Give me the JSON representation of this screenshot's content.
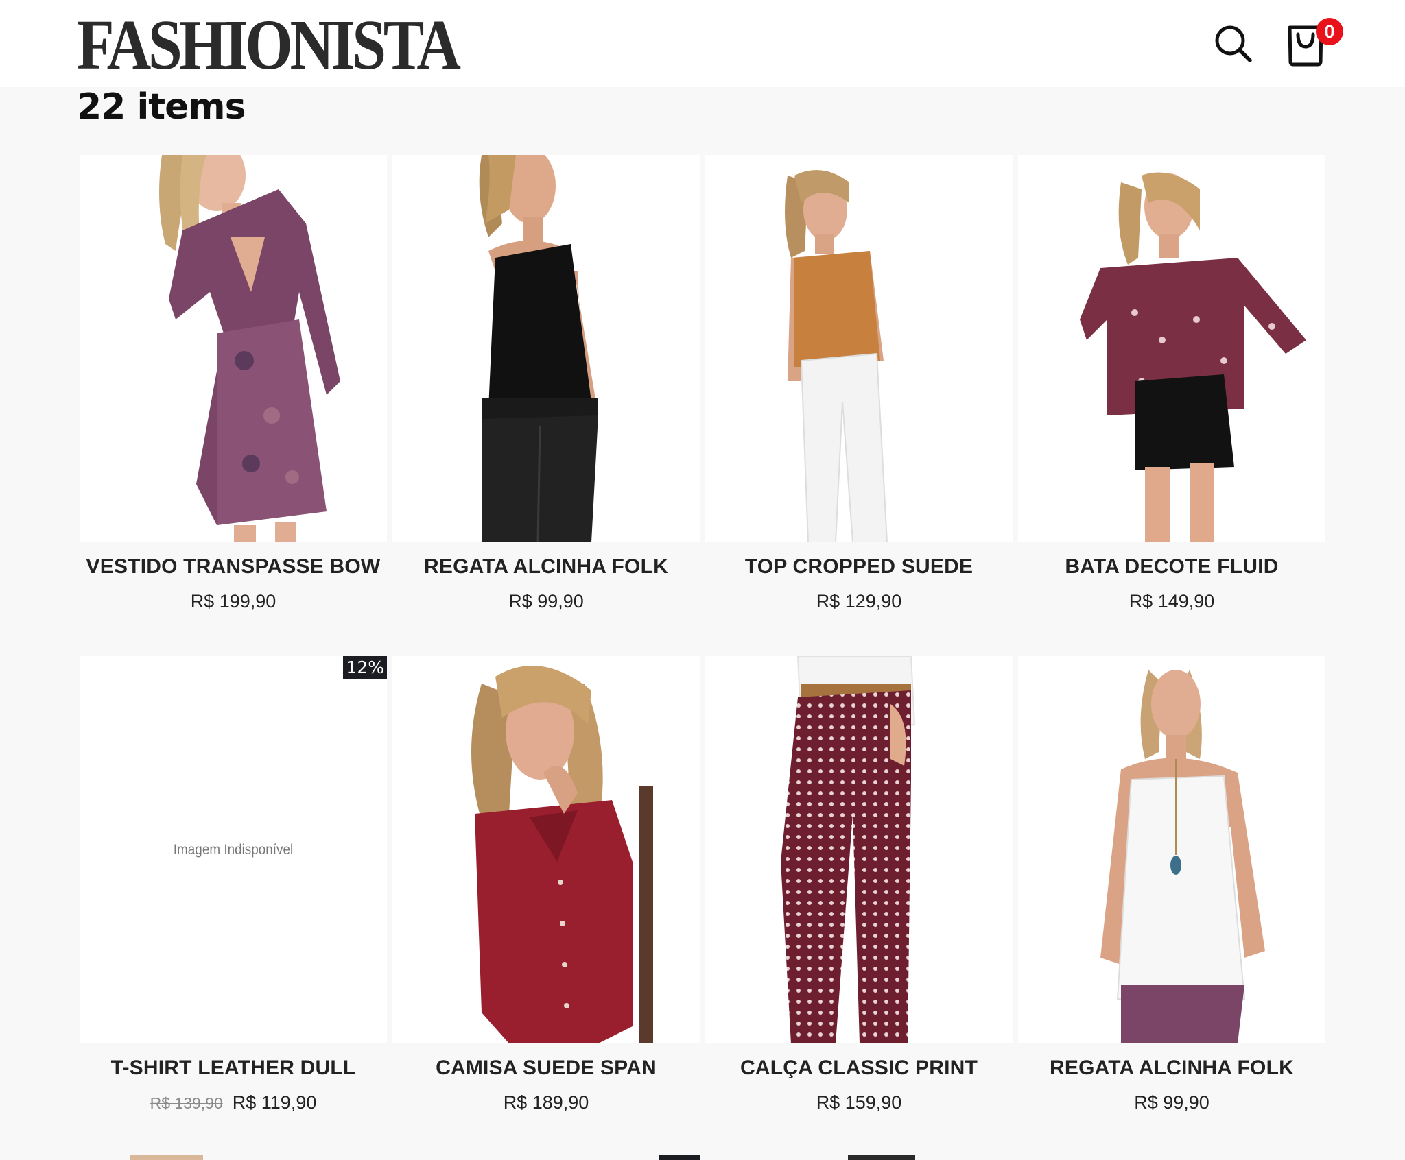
{
  "header": {
    "logo": "FASHIONISTA",
    "search_icon": "search-icon",
    "cart_icon": "shopping-bag-icon",
    "cart_count": "0",
    "badge_color": "#e8121b"
  },
  "listing": {
    "count_label": "22 items"
  },
  "products": [
    {
      "name": "VESTIDO TRANSPASSE BOW",
      "price": "R$ 199,90",
      "old_price": "",
      "discount": "",
      "image": "model-purple-paisley-dress"
    },
    {
      "name": "REGATA ALCINHA FOLK",
      "price": "R$ 99,90",
      "old_price": "",
      "discount": "",
      "image": "model-black-camisole"
    },
    {
      "name": "TOP CROPPED SUEDE",
      "price": "R$ 129,90",
      "old_price": "",
      "discount": "",
      "image": "model-orange-suede-top"
    },
    {
      "name": "BATA DECOTE FLUID",
      "price": "R$ 149,90",
      "old_price": "",
      "discount": "",
      "image": "model-burgundy-print-blouse"
    },
    {
      "name": "T-SHIRT LEATHER DULL",
      "price": "R$ 119,90",
      "old_price": "R$ 139,90",
      "discount": "12%",
      "image": "",
      "unavailable_text": "Imagem Indisponível"
    },
    {
      "name": "CAMISA SUEDE SPAN",
      "price": "R$ 189,90",
      "old_price": "",
      "discount": "",
      "image": "model-red-suede-shirt"
    },
    {
      "name": "CALÇA CLASSIC PRINT",
      "price": "R$ 159,90",
      "old_price": "",
      "discount": "",
      "image": "model-burgundy-print-pants"
    },
    {
      "name": "REGATA ALCINHA FOLK",
      "price": "R$ 99,90",
      "old_price": "",
      "discount": "",
      "image": "model-white-camisole"
    }
  ]
}
